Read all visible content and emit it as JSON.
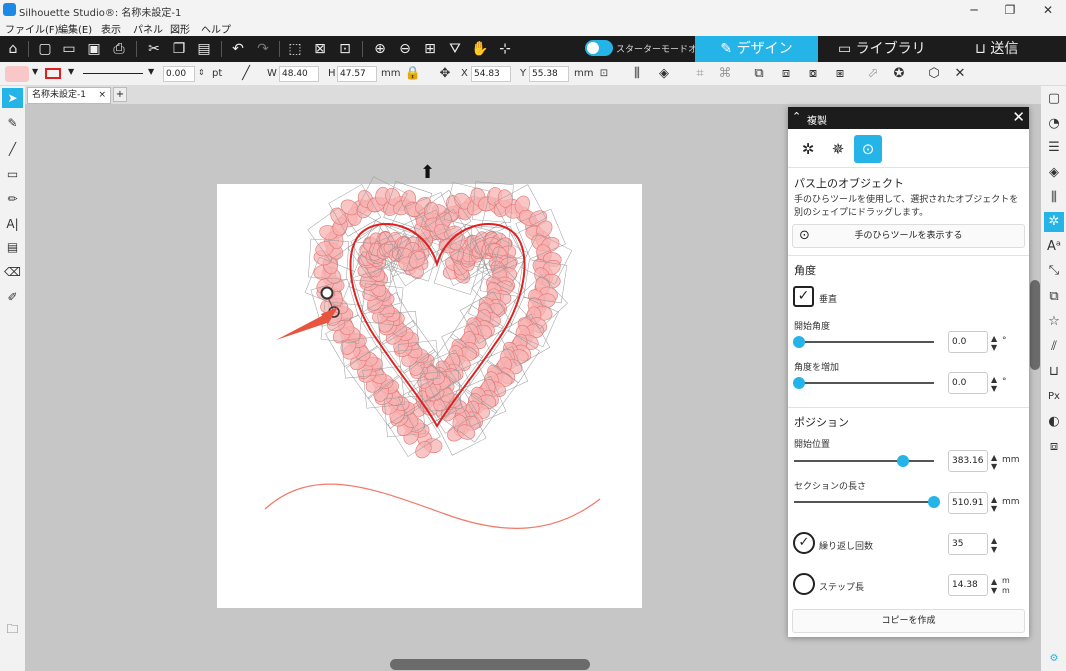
{
  "window": {
    "title": "Silhouette Studio®: 名称未設定-1",
    "minimize": "─",
    "maximize": "❐",
    "close": "✕"
  },
  "menu": [
    "ファイル(F)",
    "編集(E)",
    "表示",
    "パネル",
    "図形",
    "ヘルプ"
  ],
  "top": {
    "starter_mode": "スターターモードオフ",
    "tab_design": "✎ デザイン",
    "tab_library": "▭ ライブラリ",
    "tab_send": "⊔ 送信"
  },
  "props": {
    "stroke_width": "0.00",
    "stroke_unit": "pt",
    "w_label": "W",
    "w_value": "48.40",
    "h_label": "H",
    "h_value": "47.57",
    "size_unit": "mm",
    "x_label": "X",
    "x_value": "54.83",
    "y_label": "Y",
    "y_value": "55.38",
    "pos_unit": "mm"
  },
  "doc": {
    "tab_name": "名称未設定-1",
    "tab_close": "×",
    "add_tab": "+"
  },
  "panel": {
    "title": "複製",
    "section_path": "パス上のオブジェクト",
    "description": "手のひらツールを使用して、選択されたオブジェクトを別のシェイプにドラッグします。",
    "show_hand_tool": "手のひらツールを表示する",
    "section_angle": "角度",
    "vertical_label": "垂直",
    "vertical_checked": true,
    "start_angle_label": "開始角度",
    "start_angle": "0.0",
    "angle_increment_label": "角度を増加",
    "angle_increment": "0.0",
    "angle_unit": "°",
    "section_position": "ポジション",
    "start_position_label": "開始位置",
    "start_position": "383.16",
    "start_position_fraction": 0.78,
    "section_length_label": "セクションの長さ",
    "section_length": "510.91",
    "section_length_fraction": 1.0,
    "length_unit": "mm",
    "repeat_label": "繰り返し回数",
    "repeat_count": "35",
    "repeat_selected": true,
    "step_label": "ステップ長",
    "step_length": "14.38",
    "step_unit": "m m",
    "create_copy": "コピーを作成"
  },
  "colors": {
    "accent": "#25b4e8",
    "heart_path": "#e02020",
    "petal_fill": "#f7b3b3",
    "petal_stroke": "#e57373",
    "wave": "#f07a6a",
    "arrow": "#e8553e"
  }
}
